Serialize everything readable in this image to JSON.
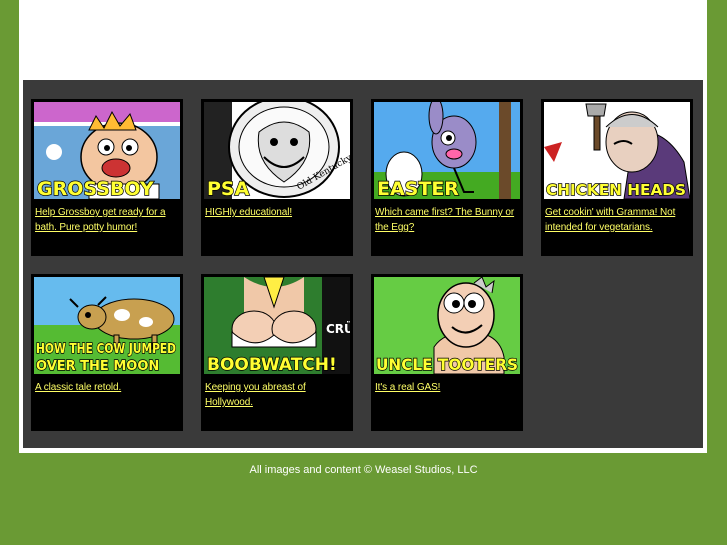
{
  "colors": {
    "background": "#6a9a34",
    "panel": "#3a3a3a",
    "link": "#ffff66",
    "title": "#ffff33"
  },
  "cartoons": [
    {
      "title": "GROSSBOY",
      "caption": "Help Grossboy get ready for a bath. Pure potty humor!",
      "icon": "grossboy-thumbnail"
    },
    {
      "title": "PSA",
      "caption": "HIGHly educational!",
      "icon": "psa-thumbnail"
    },
    {
      "title": "EASTER",
      "caption": "Which came first? The Bunny or the Egg?",
      "icon": "easter-thumbnail"
    },
    {
      "title": "CHICKEN HEADS",
      "caption": "Get cookin' with Gramma! Not intended for vegetarians.",
      "icon": "chicken-heads-thumbnail"
    },
    {
      "title_line1": "HOW THE COW JUMPED",
      "title_line2": "OVER THE MOON",
      "caption": "A classic tale retold.",
      "icon": "cow-moon-thumbnail"
    },
    {
      "title": "BOOBWATCH!",
      "caption": "Keeping you abreast of Hollywood.",
      "icon": "boobwatch-thumbnail"
    },
    {
      "title": "UNCLE TOOTERS",
      "caption": "It's a real GAS!",
      "icon": "uncle-tooters-thumbnail"
    }
  ],
  "footer": "All images and content © Weasel Studios, LLC"
}
